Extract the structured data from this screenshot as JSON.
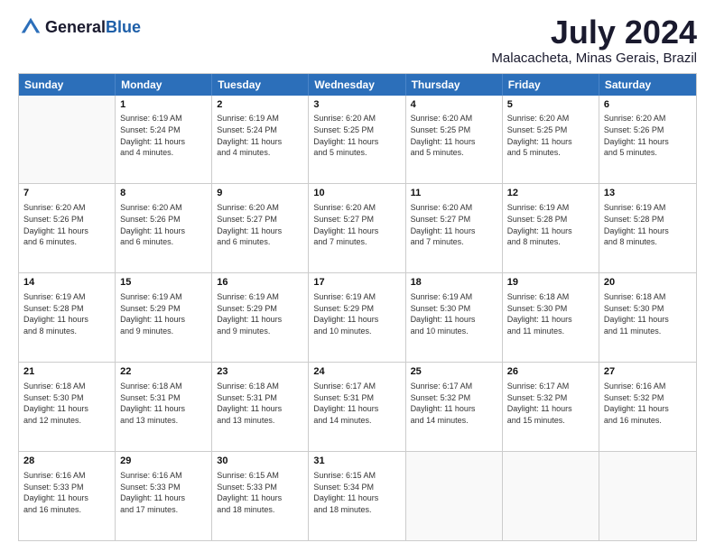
{
  "logo": {
    "general": "General",
    "blue": "Blue"
  },
  "title": "July 2024",
  "subtitle": "Malacacheta, Minas Gerais, Brazil",
  "header_days": [
    "Sunday",
    "Monday",
    "Tuesday",
    "Wednesday",
    "Thursday",
    "Friday",
    "Saturday"
  ],
  "weeks": [
    [
      {
        "day": "",
        "lines": []
      },
      {
        "day": "1",
        "lines": [
          "Sunrise: 6:19 AM",
          "Sunset: 5:24 PM",
          "Daylight: 11 hours",
          "and 4 minutes."
        ]
      },
      {
        "day": "2",
        "lines": [
          "Sunrise: 6:19 AM",
          "Sunset: 5:24 PM",
          "Daylight: 11 hours",
          "and 4 minutes."
        ]
      },
      {
        "day": "3",
        "lines": [
          "Sunrise: 6:20 AM",
          "Sunset: 5:25 PM",
          "Daylight: 11 hours",
          "and 5 minutes."
        ]
      },
      {
        "day": "4",
        "lines": [
          "Sunrise: 6:20 AM",
          "Sunset: 5:25 PM",
          "Daylight: 11 hours",
          "and 5 minutes."
        ]
      },
      {
        "day": "5",
        "lines": [
          "Sunrise: 6:20 AM",
          "Sunset: 5:25 PM",
          "Daylight: 11 hours",
          "and 5 minutes."
        ]
      },
      {
        "day": "6",
        "lines": [
          "Sunrise: 6:20 AM",
          "Sunset: 5:26 PM",
          "Daylight: 11 hours",
          "and 5 minutes."
        ]
      }
    ],
    [
      {
        "day": "7",
        "lines": [
          "Sunrise: 6:20 AM",
          "Sunset: 5:26 PM",
          "Daylight: 11 hours",
          "and 6 minutes."
        ]
      },
      {
        "day": "8",
        "lines": [
          "Sunrise: 6:20 AM",
          "Sunset: 5:26 PM",
          "Daylight: 11 hours",
          "and 6 minutes."
        ]
      },
      {
        "day": "9",
        "lines": [
          "Sunrise: 6:20 AM",
          "Sunset: 5:27 PM",
          "Daylight: 11 hours",
          "and 6 minutes."
        ]
      },
      {
        "day": "10",
        "lines": [
          "Sunrise: 6:20 AM",
          "Sunset: 5:27 PM",
          "Daylight: 11 hours",
          "and 7 minutes."
        ]
      },
      {
        "day": "11",
        "lines": [
          "Sunrise: 6:20 AM",
          "Sunset: 5:27 PM",
          "Daylight: 11 hours",
          "and 7 minutes."
        ]
      },
      {
        "day": "12",
        "lines": [
          "Sunrise: 6:19 AM",
          "Sunset: 5:28 PM",
          "Daylight: 11 hours",
          "and 8 minutes."
        ]
      },
      {
        "day": "13",
        "lines": [
          "Sunrise: 6:19 AM",
          "Sunset: 5:28 PM",
          "Daylight: 11 hours",
          "and 8 minutes."
        ]
      }
    ],
    [
      {
        "day": "14",
        "lines": [
          "Sunrise: 6:19 AM",
          "Sunset: 5:28 PM",
          "Daylight: 11 hours",
          "and 8 minutes."
        ]
      },
      {
        "day": "15",
        "lines": [
          "Sunrise: 6:19 AM",
          "Sunset: 5:29 PM",
          "Daylight: 11 hours",
          "and 9 minutes."
        ]
      },
      {
        "day": "16",
        "lines": [
          "Sunrise: 6:19 AM",
          "Sunset: 5:29 PM",
          "Daylight: 11 hours",
          "and 9 minutes."
        ]
      },
      {
        "day": "17",
        "lines": [
          "Sunrise: 6:19 AM",
          "Sunset: 5:29 PM",
          "Daylight: 11 hours",
          "and 10 minutes."
        ]
      },
      {
        "day": "18",
        "lines": [
          "Sunrise: 6:19 AM",
          "Sunset: 5:30 PM",
          "Daylight: 11 hours",
          "and 10 minutes."
        ]
      },
      {
        "day": "19",
        "lines": [
          "Sunrise: 6:18 AM",
          "Sunset: 5:30 PM",
          "Daylight: 11 hours",
          "and 11 minutes."
        ]
      },
      {
        "day": "20",
        "lines": [
          "Sunrise: 6:18 AM",
          "Sunset: 5:30 PM",
          "Daylight: 11 hours",
          "and 11 minutes."
        ]
      }
    ],
    [
      {
        "day": "21",
        "lines": [
          "Sunrise: 6:18 AM",
          "Sunset: 5:30 PM",
          "Daylight: 11 hours",
          "and 12 minutes."
        ]
      },
      {
        "day": "22",
        "lines": [
          "Sunrise: 6:18 AM",
          "Sunset: 5:31 PM",
          "Daylight: 11 hours",
          "and 13 minutes."
        ]
      },
      {
        "day": "23",
        "lines": [
          "Sunrise: 6:18 AM",
          "Sunset: 5:31 PM",
          "Daylight: 11 hours",
          "and 13 minutes."
        ]
      },
      {
        "day": "24",
        "lines": [
          "Sunrise: 6:17 AM",
          "Sunset: 5:31 PM",
          "Daylight: 11 hours",
          "and 14 minutes."
        ]
      },
      {
        "day": "25",
        "lines": [
          "Sunrise: 6:17 AM",
          "Sunset: 5:32 PM",
          "Daylight: 11 hours",
          "and 14 minutes."
        ]
      },
      {
        "day": "26",
        "lines": [
          "Sunrise: 6:17 AM",
          "Sunset: 5:32 PM",
          "Daylight: 11 hours",
          "and 15 minutes."
        ]
      },
      {
        "day": "27",
        "lines": [
          "Sunrise: 6:16 AM",
          "Sunset: 5:32 PM",
          "Daylight: 11 hours",
          "and 16 minutes."
        ]
      }
    ],
    [
      {
        "day": "28",
        "lines": [
          "Sunrise: 6:16 AM",
          "Sunset: 5:33 PM",
          "Daylight: 11 hours",
          "and 16 minutes."
        ]
      },
      {
        "day": "29",
        "lines": [
          "Sunrise: 6:16 AM",
          "Sunset: 5:33 PM",
          "Daylight: 11 hours",
          "and 17 minutes."
        ]
      },
      {
        "day": "30",
        "lines": [
          "Sunrise: 6:15 AM",
          "Sunset: 5:33 PM",
          "Daylight: 11 hours",
          "and 18 minutes."
        ]
      },
      {
        "day": "31",
        "lines": [
          "Sunrise: 6:15 AM",
          "Sunset: 5:34 PM",
          "Daylight: 11 hours",
          "and 18 minutes."
        ]
      },
      {
        "day": "",
        "lines": []
      },
      {
        "day": "",
        "lines": []
      },
      {
        "day": "",
        "lines": []
      }
    ]
  ]
}
